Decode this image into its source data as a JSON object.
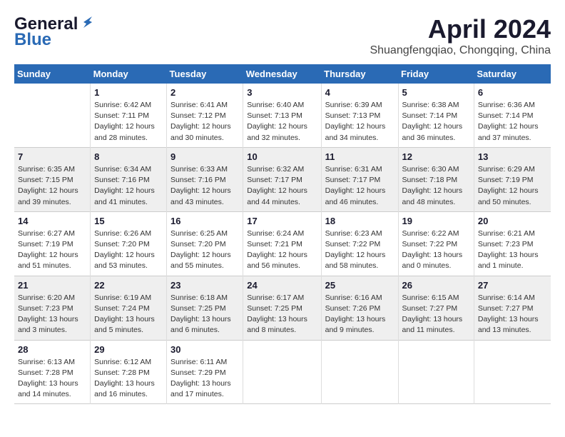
{
  "header": {
    "logo_line1": "General",
    "logo_line2": "Blue",
    "month": "April 2024",
    "location": "Shuangfengqiao, Chongqing, China"
  },
  "days_of_week": [
    "Sunday",
    "Monday",
    "Tuesday",
    "Wednesday",
    "Thursday",
    "Friday",
    "Saturday"
  ],
  "weeks": [
    [
      {
        "day": "",
        "sunrise": "",
        "sunset": "",
        "daylight": ""
      },
      {
        "day": "1",
        "sunrise": "Sunrise: 6:42 AM",
        "sunset": "Sunset: 7:11 PM",
        "daylight": "Daylight: 12 hours and 28 minutes."
      },
      {
        "day": "2",
        "sunrise": "Sunrise: 6:41 AM",
        "sunset": "Sunset: 7:12 PM",
        "daylight": "Daylight: 12 hours and 30 minutes."
      },
      {
        "day": "3",
        "sunrise": "Sunrise: 6:40 AM",
        "sunset": "Sunset: 7:13 PM",
        "daylight": "Daylight: 12 hours and 32 minutes."
      },
      {
        "day": "4",
        "sunrise": "Sunrise: 6:39 AM",
        "sunset": "Sunset: 7:13 PM",
        "daylight": "Daylight: 12 hours and 34 minutes."
      },
      {
        "day": "5",
        "sunrise": "Sunrise: 6:38 AM",
        "sunset": "Sunset: 7:14 PM",
        "daylight": "Daylight: 12 hours and 36 minutes."
      },
      {
        "day": "6",
        "sunrise": "Sunrise: 6:36 AM",
        "sunset": "Sunset: 7:14 PM",
        "daylight": "Daylight: 12 hours and 37 minutes."
      }
    ],
    [
      {
        "day": "7",
        "sunrise": "Sunrise: 6:35 AM",
        "sunset": "Sunset: 7:15 PM",
        "daylight": "Daylight: 12 hours and 39 minutes."
      },
      {
        "day": "8",
        "sunrise": "Sunrise: 6:34 AM",
        "sunset": "Sunset: 7:16 PM",
        "daylight": "Daylight: 12 hours and 41 minutes."
      },
      {
        "day": "9",
        "sunrise": "Sunrise: 6:33 AM",
        "sunset": "Sunset: 7:16 PM",
        "daylight": "Daylight: 12 hours and 43 minutes."
      },
      {
        "day": "10",
        "sunrise": "Sunrise: 6:32 AM",
        "sunset": "Sunset: 7:17 PM",
        "daylight": "Daylight: 12 hours and 44 minutes."
      },
      {
        "day": "11",
        "sunrise": "Sunrise: 6:31 AM",
        "sunset": "Sunset: 7:17 PM",
        "daylight": "Daylight: 12 hours and 46 minutes."
      },
      {
        "day": "12",
        "sunrise": "Sunrise: 6:30 AM",
        "sunset": "Sunset: 7:18 PM",
        "daylight": "Daylight: 12 hours and 48 minutes."
      },
      {
        "day": "13",
        "sunrise": "Sunrise: 6:29 AM",
        "sunset": "Sunset: 7:19 PM",
        "daylight": "Daylight: 12 hours and 50 minutes."
      }
    ],
    [
      {
        "day": "14",
        "sunrise": "Sunrise: 6:27 AM",
        "sunset": "Sunset: 7:19 PM",
        "daylight": "Daylight: 12 hours and 51 minutes."
      },
      {
        "day": "15",
        "sunrise": "Sunrise: 6:26 AM",
        "sunset": "Sunset: 7:20 PM",
        "daylight": "Daylight: 12 hours and 53 minutes."
      },
      {
        "day": "16",
        "sunrise": "Sunrise: 6:25 AM",
        "sunset": "Sunset: 7:20 PM",
        "daylight": "Daylight: 12 hours and 55 minutes."
      },
      {
        "day": "17",
        "sunrise": "Sunrise: 6:24 AM",
        "sunset": "Sunset: 7:21 PM",
        "daylight": "Daylight: 12 hours and 56 minutes."
      },
      {
        "day": "18",
        "sunrise": "Sunrise: 6:23 AM",
        "sunset": "Sunset: 7:22 PM",
        "daylight": "Daylight: 12 hours and 58 minutes."
      },
      {
        "day": "19",
        "sunrise": "Sunrise: 6:22 AM",
        "sunset": "Sunset: 7:22 PM",
        "daylight": "Daylight: 13 hours and 0 minutes."
      },
      {
        "day": "20",
        "sunrise": "Sunrise: 6:21 AM",
        "sunset": "Sunset: 7:23 PM",
        "daylight": "Daylight: 13 hours and 1 minute."
      }
    ],
    [
      {
        "day": "21",
        "sunrise": "Sunrise: 6:20 AM",
        "sunset": "Sunset: 7:23 PM",
        "daylight": "Daylight: 13 hours and 3 minutes."
      },
      {
        "day": "22",
        "sunrise": "Sunrise: 6:19 AM",
        "sunset": "Sunset: 7:24 PM",
        "daylight": "Daylight: 13 hours and 5 minutes."
      },
      {
        "day": "23",
        "sunrise": "Sunrise: 6:18 AM",
        "sunset": "Sunset: 7:25 PM",
        "daylight": "Daylight: 13 hours and 6 minutes."
      },
      {
        "day": "24",
        "sunrise": "Sunrise: 6:17 AM",
        "sunset": "Sunset: 7:25 PM",
        "daylight": "Daylight: 13 hours and 8 minutes."
      },
      {
        "day": "25",
        "sunrise": "Sunrise: 6:16 AM",
        "sunset": "Sunset: 7:26 PM",
        "daylight": "Daylight: 13 hours and 9 minutes."
      },
      {
        "day": "26",
        "sunrise": "Sunrise: 6:15 AM",
        "sunset": "Sunset: 7:27 PM",
        "daylight": "Daylight: 13 hours and 11 minutes."
      },
      {
        "day": "27",
        "sunrise": "Sunrise: 6:14 AM",
        "sunset": "Sunset: 7:27 PM",
        "daylight": "Daylight: 13 hours and 13 minutes."
      }
    ],
    [
      {
        "day": "28",
        "sunrise": "Sunrise: 6:13 AM",
        "sunset": "Sunset: 7:28 PM",
        "daylight": "Daylight: 13 hours and 14 minutes."
      },
      {
        "day": "29",
        "sunrise": "Sunrise: 6:12 AM",
        "sunset": "Sunset: 7:28 PM",
        "daylight": "Daylight: 13 hours and 16 minutes."
      },
      {
        "day": "30",
        "sunrise": "Sunrise: 6:11 AM",
        "sunset": "Sunset: 7:29 PM",
        "daylight": "Daylight: 13 hours and 17 minutes."
      },
      {
        "day": "",
        "sunrise": "",
        "sunset": "",
        "daylight": ""
      },
      {
        "day": "",
        "sunrise": "",
        "sunset": "",
        "daylight": ""
      },
      {
        "day": "",
        "sunrise": "",
        "sunset": "",
        "daylight": ""
      },
      {
        "day": "",
        "sunrise": "",
        "sunset": "",
        "daylight": ""
      }
    ]
  ]
}
